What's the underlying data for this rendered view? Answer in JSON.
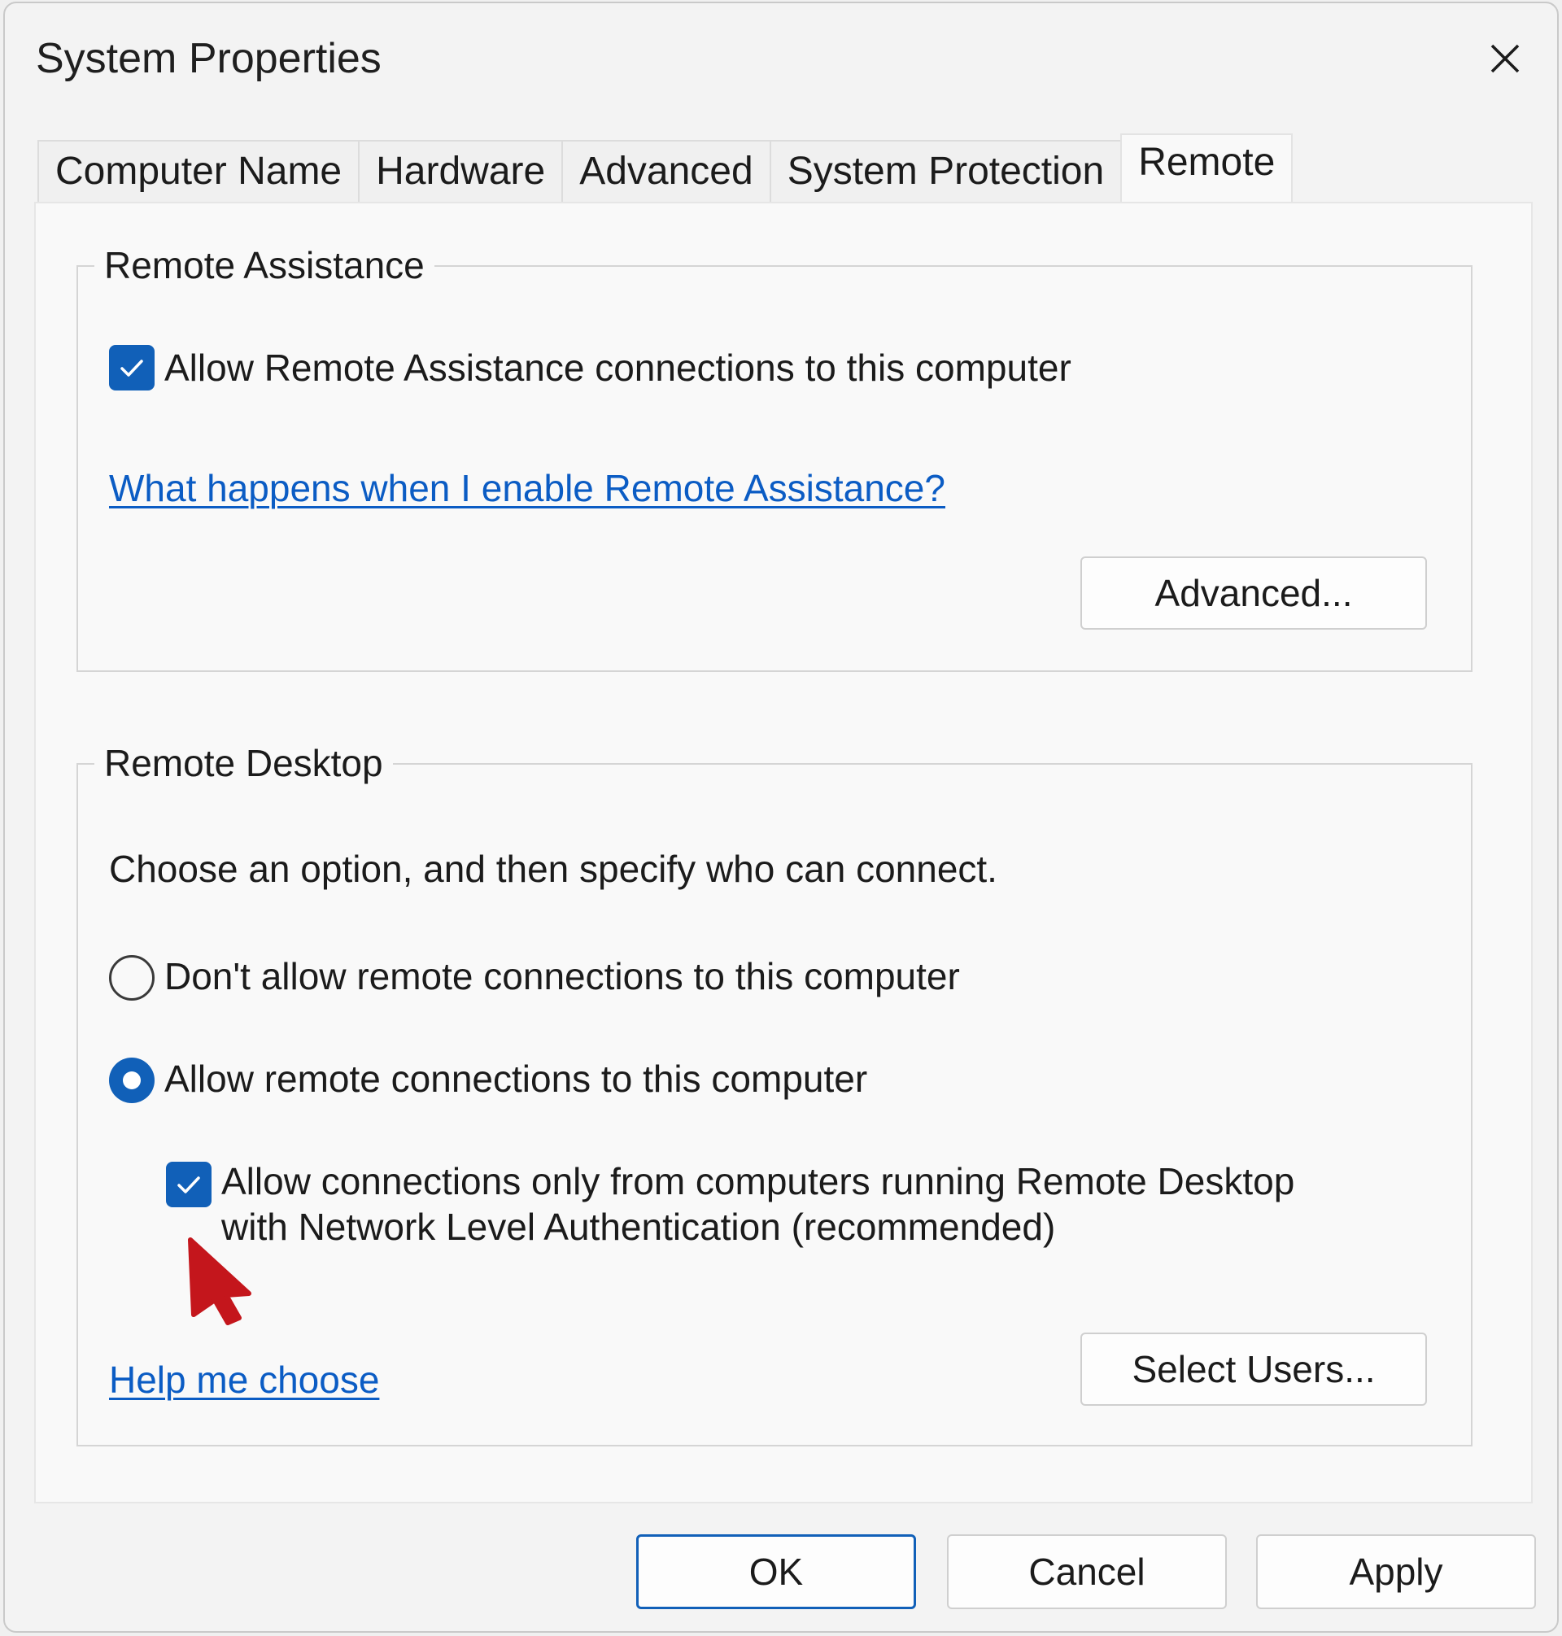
{
  "window": {
    "title": "System Properties"
  },
  "tabs": [
    {
      "label": "Computer Name",
      "active": false
    },
    {
      "label": "Hardware",
      "active": false
    },
    {
      "label": "Advanced",
      "active": false
    },
    {
      "label": "System Protection",
      "active": false
    },
    {
      "label": "Remote",
      "active": true
    }
  ],
  "remote_assistance": {
    "group_title": "Remote Assistance",
    "allow_checkbox_label": "Allow Remote Assistance connections to this computer",
    "allow_checked": true,
    "help_link": "What happens when I enable Remote Assistance?",
    "advanced_button": "Advanced..."
  },
  "remote_desktop": {
    "group_title": "Remote Desktop",
    "instructions": "Choose an option, and then specify who can connect.",
    "option_dont_allow": "Don't allow remote connections to this computer",
    "option_allow": "Allow remote connections to this computer",
    "selected_option": "allow",
    "nla_line1": "Allow connections only from computers running Remote Desktop",
    "nla_line2": "with Network Level Authentication (recommended)",
    "nla_checked": true,
    "help_link": "Help me choose",
    "select_users_button": "Select Users..."
  },
  "footer": {
    "ok": "OK",
    "cancel": "Cancel",
    "apply": "Apply"
  },
  "colors": {
    "accent": "#1160b8",
    "link": "#0b5cc4",
    "cursor": "#c4161c"
  },
  "icons": {
    "close": "close-icon",
    "check": "checkmark-icon",
    "cursor": "mouse-pointer-icon"
  }
}
